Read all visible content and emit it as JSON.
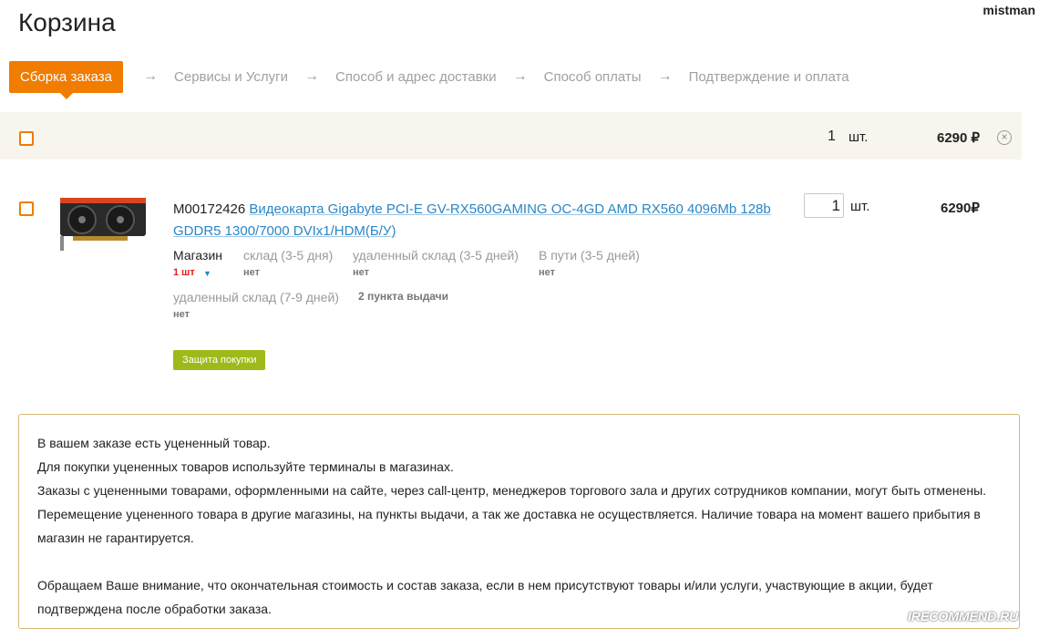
{
  "header": {
    "title": "Корзина",
    "username": "mistman"
  },
  "steps": [
    {
      "label": "Сборка заказа",
      "active": true
    },
    {
      "label": "Сервисы и Услуги",
      "active": false
    },
    {
      "label": "Способ и адрес доставки",
      "active": false
    },
    {
      "label": "Способ оплаты",
      "active": false
    },
    {
      "label": "Подтверждение и оплата",
      "active": false
    }
  ],
  "step_arrow": "→",
  "summary": {
    "qty": "1",
    "unit": "шт.",
    "total": "6290 ₽",
    "remove_glyph": "×"
  },
  "item": {
    "code": "M00172426",
    "name": "Видеокарта Gigabyte PCI-E GV-RX560GAMING OC-4GD AMD RX560 4096Mb 128b GDDR5 1300/7000 DVIx1/HDM(Б/У)",
    "qty": "1",
    "unit": "шт.",
    "price": "6290₽",
    "image_icon": "graphics-card-icon",
    "availability": [
      {
        "label": "Магазин",
        "value": "1 шт"
      },
      {
        "label": "склад (3-5 дня)",
        "value": "нет"
      },
      {
        "label": "удаленный склад (3-5 дней)",
        "value": "нет"
      },
      {
        "label": "В пути (3-5 дней)",
        "value": "нет"
      },
      {
        "label": "удаленный склад (7-9 дней)",
        "value": "нет"
      }
    ],
    "pickup_points": "2 пункта выдачи",
    "protect_label": "Защита покупки"
  },
  "notice": {
    "lines": [
      "В вашем заказе есть уцененный товар.",
      "Для покупки уцененных товаров используйте терминалы в магазинах.",
      "Заказы с уцененными товарами, оформленными на сайте, через call-центр, менеджеров торгового зала и других сотрудников компании, могут быть отменены. Перемещение уцененного товара в другие магазины, на пункты выдачи, а так же доставка не осуществляется. Наличие товара на момент вашего прибытия в магазин не гарантируется."
    ],
    "footer": "Обращаем Ваше внимание, что окончательная стоимость и состав заказа, если в нем присутствуют товары и/или услуги, участвующие в акции, будет подтверждена после обработки заказа."
  },
  "watermark": "IRECOMMEND.RU",
  "colors": {
    "accent": "#f07c00",
    "link": "#2a86c5",
    "protect": "#9dba1a",
    "notice_border": "#d9b878",
    "summary_bg": "#f8f5ee"
  }
}
